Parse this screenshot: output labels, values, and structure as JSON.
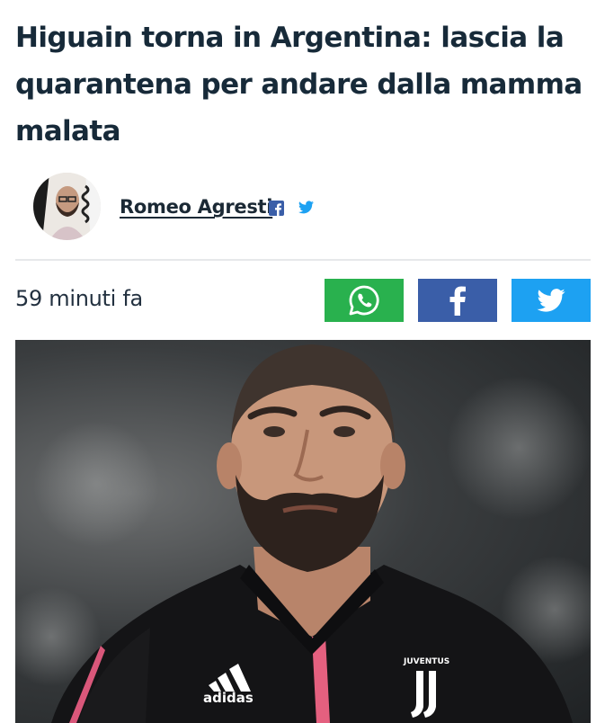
{
  "article": {
    "headline": "Higuain torna in Argentina: lascia la quarantena per andare dalla mamma malata",
    "published": "59 minuti fa"
  },
  "author": {
    "name": "Romeo Agresti",
    "social": [
      "facebook-icon",
      "twitter-icon"
    ]
  },
  "share": {
    "buttons": [
      "whatsapp",
      "facebook",
      "twitter"
    ],
    "colors": {
      "whatsapp": "#29b14e",
      "facebook": "#3a5ea8",
      "twitter": "#1da1f2"
    }
  },
  "hero_image": {
    "jersey_brand": "adidas",
    "jersey_club": "JUVENTUS"
  }
}
